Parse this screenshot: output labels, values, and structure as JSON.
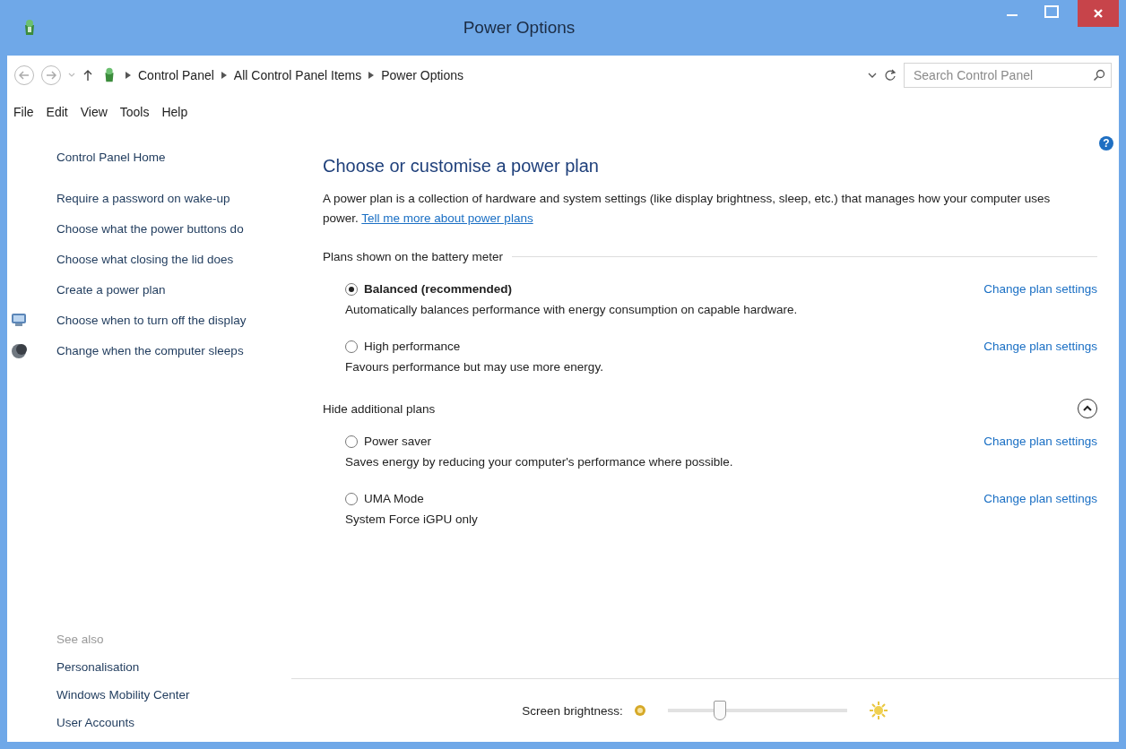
{
  "window": {
    "title": "Power Options"
  },
  "address_bar": {
    "breadcrumbs": [
      "Control Panel",
      "All Control Panel Items",
      "Power Options"
    ],
    "search": {
      "placeholder": "Search Control Panel"
    }
  },
  "menu": [
    "File",
    "Edit",
    "View",
    "Tools",
    "Help"
  ],
  "sidebar": {
    "home": "Control Panel Home",
    "tasks": [
      {
        "label": "Require a password on wake-up",
        "kind": "plain"
      },
      {
        "label": "Choose what the power buttons do",
        "kind": "plain"
      },
      {
        "label": "Choose what closing the lid does",
        "kind": "plain"
      },
      {
        "label": "Create a power plan",
        "kind": "plain"
      },
      {
        "label": "Choose when to turn off the display",
        "kind": "display"
      },
      {
        "label": "Change when the computer sleeps",
        "kind": "sleep"
      }
    ],
    "see_also": {
      "heading": "See also",
      "links": [
        "Personalisation",
        "Windows Mobility Center",
        "User Accounts"
      ]
    }
  },
  "main": {
    "help": "?",
    "heading": "Choose or customise a power plan",
    "intro": "A power plan is a collection of hardware and system settings (like display brightness, sleep, etc.) that manages how your computer uses power.",
    "intro_link": "Tell me more about power plans",
    "groups": [
      {
        "heading": "Plans shown on the battery meter",
        "kind": "fixed",
        "plans": [
          {
            "name": "Balanced (recommended)",
            "selected": true,
            "description": "Automatically balances performance with energy consumption on capable hardware.",
            "link": "Change plan settings"
          },
          {
            "name": "High performance",
            "selected": false,
            "description": "Favours performance but may use more energy.",
            "link": "Change plan settings"
          }
        ]
      },
      {
        "heading": "Hide additional plans",
        "kind": "collapsible",
        "expanded": true,
        "plans": [
          {
            "name": "Power saver",
            "selected": false,
            "description": "Saves energy by reducing your computer's performance where possible.",
            "link": "Change plan settings"
          },
          {
            "name": "UMA Mode",
            "selected": false,
            "description": "System Force iGPU only",
            "link": "Change plan settings"
          }
        ]
      }
    ]
  },
  "brightness": {
    "label": "Screen brightness:",
    "level": 0.29
  }
}
